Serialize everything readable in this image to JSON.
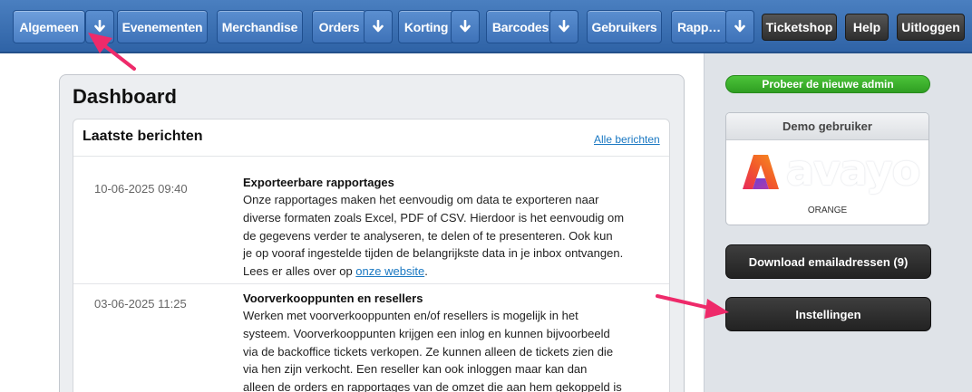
{
  "nav": {
    "items": [
      {
        "label": "Algemeen",
        "has_dropdown": true,
        "active": true
      },
      {
        "label": "Evenementen",
        "has_dropdown": false
      },
      {
        "label": "Merchandise",
        "has_dropdown": false
      },
      {
        "label": "Orders",
        "has_dropdown": true
      },
      {
        "label": "Korting",
        "has_dropdown": true
      },
      {
        "label": "Barcodes",
        "has_dropdown": true
      },
      {
        "label": "Gebruikers",
        "has_dropdown": false
      },
      {
        "label": "Rapp…",
        "has_dropdown": true
      }
    ],
    "right": {
      "ticketshop": "Ticketshop",
      "help": "Help",
      "logout": "Uitloggen"
    },
    "dropdown_icon": "arrow-down-icon"
  },
  "main": {
    "title": "Dashboard",
    "messages": {
      "title": "Laatste berichten",
      "all_link": "Alle berichten",
      "items": [
        {
          "date": "10-06-2025 09:40",
          "title": "Exporteerbare rapportages",
          "lines": [
            "Onze rapportages maken het eenvoudig om data te exporteren naar",
            "diverse formaten zoals Excel, PDF of CSV. Hierdoor is het eenvoudig om",
            "de gegevens verder te analyseren, te delen of te presenteren. Ook kun",
            "je op vooraf ingestelde tijden de belangrijkste data in je inbox ontvangen."
          ],
          "last_line_prefix": "Lees er alles over op ",
          "link_text": "onze website",
          "last_line_suffix": "."
        },
        {
          "date": "03-06-2025 11:25",
          "title": "Voorverkooppunten en resellers",
          "lines": [
            "Werken met voorverkooppunten en/of resellers is mogelijk in het",
            "systeem. Voorverkooppunten krijgen een inlog en kunnen bijvoorbeeld",
            "via de backoffice tickets verkopen. Ze kunnen alleen de tickets zien die",
            "via hen zijn verkocht.  Een reseller kan ook inloggen maar kan dan",
            "alleen de orders en rapportages van de omzet die aan hem gekoppeld is"
          ]
        }
      ]
    }
  },
  "sidebar": {
    "try_new_admin": "Probeer de nieuwe admin",
    "demo_user": {
      "heading": "Demo gebruiker",
      "logo_text": "avayo",
      "caption": "ORANGE"
    },
    "download_emails": "Download emailadressen (9)",
    "settings": "Instellingen"
  },
  "colors": {
    "nav_blue": "#3e72b8",
    "try_green": "#34a826",
    "dark_button": "#2e2e2e",
    "link_blue": "#1a78c2",
    "annotation_pink": "#ee2a6a"
  }
}
